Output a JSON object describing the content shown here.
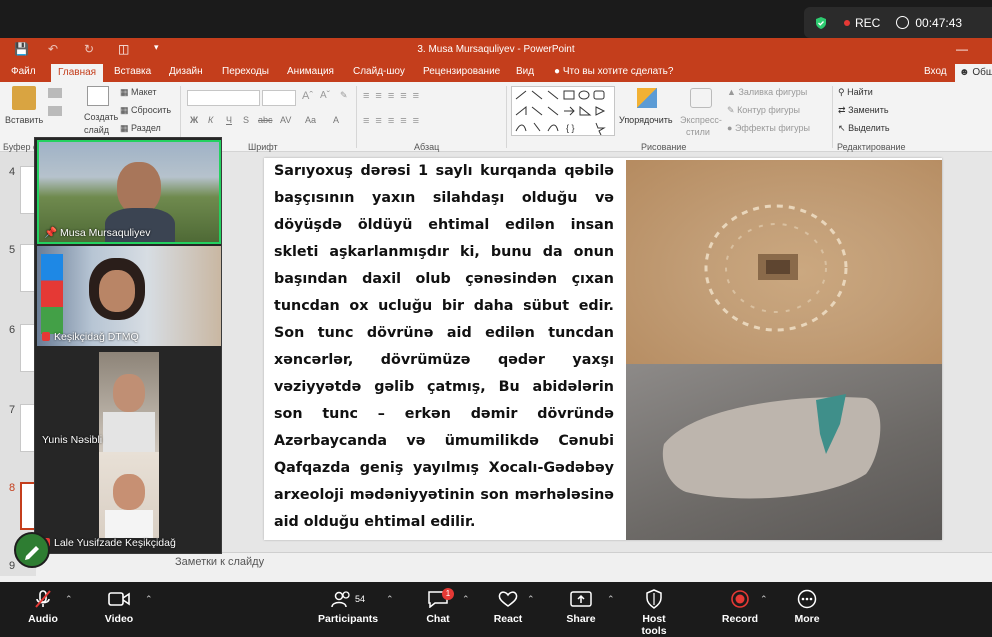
{
  "zoom": {
    "rec_label": "REC",
    "timer": "00:47:43",
    "toolbar": {
      "audio": "Audio",
      "video": "Video",
      "participants": "Participants",
      "participants_count": "54",
      "chat": "Chat",
      "chat_badge": "1",
      "react": "React",
      "share": "Share",
      "host_tools": "Host tools",
      "record": "Record",
      "more": "More"
    },
    "participants": [
      {
        "name": "Musa Mursaquliyev"
      },
      {
        "name": "Keşikçidağ DTMQ"
      },
      {
        "name": "Yunis Nəsibli"
      },
      {
        "name": "Lale Yusifzade Keşikçidağ"
      }
    ]
  },
  "powerpoint": {
    "window_title": "3. Musa Mursaquliyev - PowerPoint",
    "tabs": [
      "Файл",
      "Главная",
      "Вставка",
      "Дизайн",
      "Переходы",
      "Анимация",
      "Слайд-шоу",
      "Рецензирование",
      "Вид"
    ],
    "tell_me": "Что вы хотите сделать?",
    "sign_in": "Вход",
    "share_partial": "Общ",
    "ribbon": {
      "paste": "Вставить",
      "clipboard_group": "Буфер о",
      "new_slide_1": "Создать",
      "new_slide_2": "слайд",
      "layout": "Макет",
      "reset": "Сбросить",
      "section": "Раздел",
      "font_group": "Шрифт",
      "paragraph_group": "Абзац",
      "arrange_1": "Упорядочить",
      "quick_styles_1": "Экспресс-",
      "quick_styles_2": "стили",
      "shape_fill": "Заливка фигуры",
      "shape_outline": "Контур фигуры",
      "shape_effects": "Эффекты фигуры",
      "drawing_group": "Рисование",
      "find": "Найти",
      "replace": "Заменить",
      "select": "Выделить",
      "editing_group": "Редактирование",
      "bold": "Ж",
      "italic": "К",
      "underline": "Ч",
      "strike": "S",
      "shadow": "abc",
      "font_color": "А"
    },
    "slide_numbers": [
      "4",
      "5",
      "6",
      "7",
      "8",
      "9"
    ],
    "notes_placeholder": "Заметки к слайду",
    "slide_text": "Sarıyoxuş dərəsi 1 saylı kurqanda qəbilə başçısının yaxın silahdaşı olduğu və döyüşdə öldüyü ehtimal edilən insan skleti aşkarlanmışdır ki, bunu da onun başından daxil olub çənəsindən çıxan tuncdan ox ucluğu bir daha sübut edir. Son tunc dövrünə aid edilən tuncdan xəncərlər, dövrümüzə qədər yaxşı vəziyyətdə gəlib çatmış, Bu abidələrin son tunc – erkən dəmir dövründə Azərbaycanda və ümumilikdə Cənubi Qafqazda geniş yayılmış Xocalı-Gədəbəy arxeoloji mədəniyyətinin son mərhələsinə aid olduğu ehtimal edilir."
  }
}
